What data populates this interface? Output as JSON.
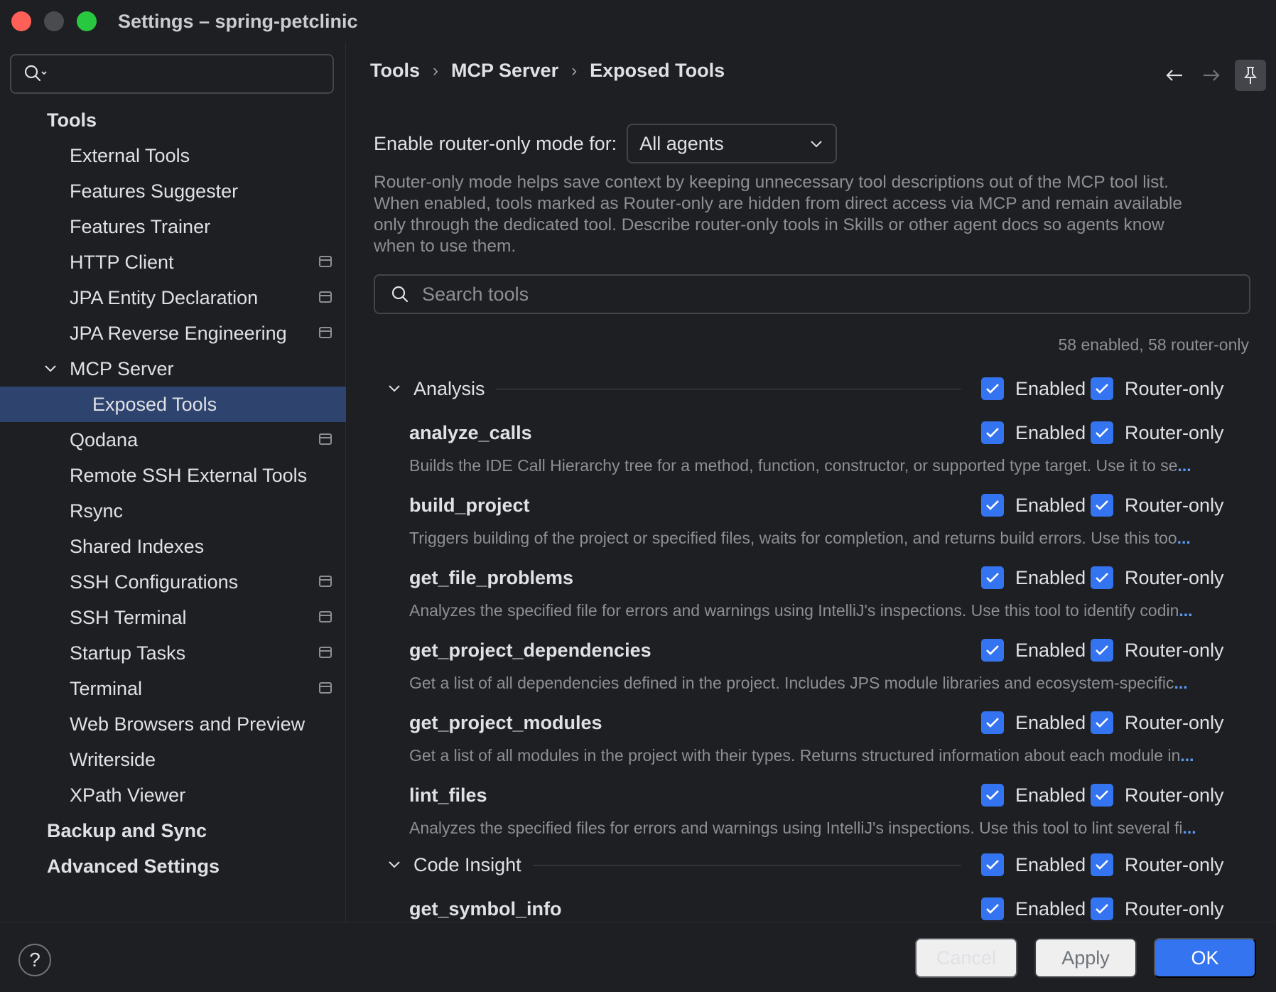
{
  "window": {
    "title": "Settings – spring-petclinic"
  },
  "sidebar": {
    "search_placeholder": "",
    "items": [
      {
        "label": "Tools",
        "level": 0
      },
      {
        "label": "External Tools",
        "level": 1
      },
      {
        "label": "Features Suggester",
        "level": 1
      },
      {
        "label": "Features Trainer",
        "level": 1
      },
      {
        "label": "HTTP Client",
        "level": 1,
        "project": true
      },
      {
        "label": "JPA Entity Declaration",
        "level": 1,
        "project": true
      },
      {
        "label": "JPA Reverse Engineering",
        "level": 1,
        "project": true
      },
      {
        "label": "MCP Server",
        "level": 1,
        "expanded": true
      },
      {
        "label": "Exposed Tools",
        "level": 2,
        "selected": true
      },
      {
        "label": "Qodana",
        "level": 1,
        "project": true
      },
      {
        "label": "Remote SSH External Tools",
        "level": 1
      },
      {
        "label": "Rsync",
        "level": 1
      },
      {
        "label": "Shared Indexes",
        "level": 1
      },
      {
        "label": "SSH Configurations",
        "level": 1,
        "project": true
      },
      {
        "label": "SSH Terminal",
        "level": 1,
        "project": true
      },
      {
        "label": "Startup Tasks",
        "level": 1,
        "project": true
      },
      {
        "label": "Terminal",
        "level": 1,
        "project": true
      },
      {
        "label": "Web Browsers and Preview",
        "level": 1
      },
      {
        "label": "Writerside",
        "level": 1
      },
      {
        "label": "XPath Viewer",
        "level": 1
      },
      {
        "label": "Backup and Sync",
        "level": 0
      },
      {
        "label": "Advanced Settings",
        "level": 0
      }
    ]
  },
  "breadcrumb": {
    "items": [
      "Tools",
      "MCP Server",
      "Exposed Tools"
    ]
  },
  "router": {
    "label": "Enable router-only mode for:",
    "selected": "All agents",
    "description": "Router-only mode helps save context by keeping unnecessary tool descriptions out of the MCP tool list. When enabled, tools marked as Router-only are hidden from direct access via MCP and remain available only through the dedicated tool. Describe router-only tools in Skills or other agent docs so agents know when to use them."
  },
  "search": {
    "placeholder": "Search tools",
    "value": ""
  },
  "counts": "58 enabled, 58 router-only",
  "labels": {
    "enabled": "Enabled",
    "router_only": "Router-only",
    "more": "..."
  },
  "groups": [
    {
      "name": "Analysis",
      "enabled": true,
      "router_only": true,
      "tools": [
        {
          "name": "analyze_calls",
          "desc": "Builds the IDE Call Hierarchy tree for a method, function, constructor, or supported type target. Use it to se",
          "enabled": true,
          "router_only": true
        },
        {
          "name": "build_project",
          "desc": "Triggers building of the project or specified files, waits for completion, and returns build errors. Use this too",
          "enabled": true,
          "router_only": true
        },
        {
          "name": "get_file_problems",
          "desc": "Analyzes the specified file for errors and warnings using IntelliJ's inspections. Use this tool to identify codin",
          "enabled": true,
          "router_only": true
        },
        {
          "name": "get_project_dependencies",
          "desc": "Get a list of all dependencies defined in the project. Includes JPS module libraries and ecosystem-specific",
          "enabled": true,
          "router_only": true
        },
        {
          "name": "get_project_modules",
          "desc": "Get a list of all modules in the project with their types. Returns structured information about each module in",
          "enabled": true,
          "router_only": true
        },
        {
          "name": "lint_files",
          "desc": "Analyzes the specified files for errors and warnings using IntelliJ's inspections. Use this tool to lint several fi",
          "enabled": true,
          "router_only": true
        }
      ]
    },
    {
      "name": "Code Insight",
      "enabled": true,
      "router_only": true,
      "tools": [
        {
          "name": "get_symbol_info",
          "desc": "",
          "enabled": true,
          "router_only": true
        }
      ]
    }
  ],
  "footer": {
    "help": "?",
    "cancel": "Cancel",
    "apply": "Apply",
    "ok": "OK"
  },
  "colors": {
    "accent": "#3574f0",
    "selection": "#2e436e",
    "background": "#1e1f22",
    "muted_text": "#8c8f94"
  }
}
